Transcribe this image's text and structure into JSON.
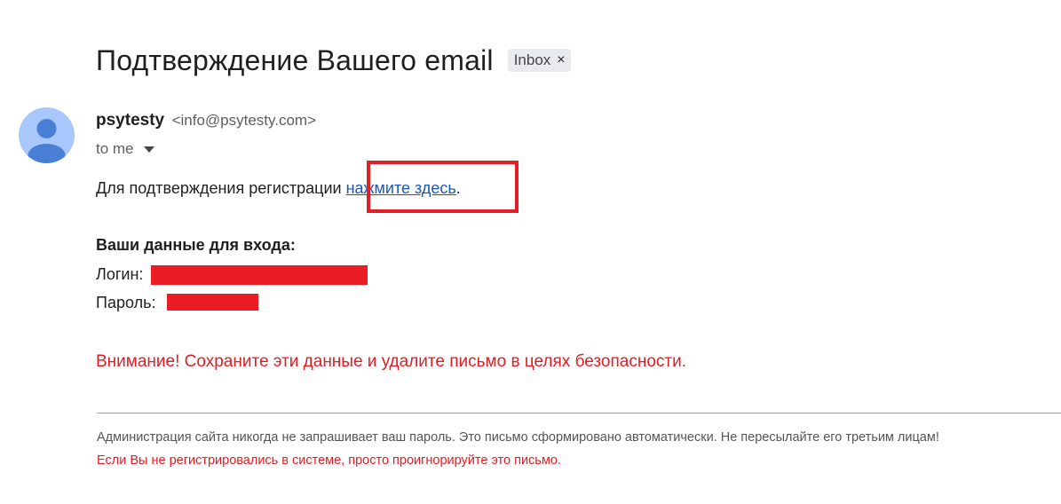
{
  "email": {
    "subject": "Подтверждение Вашего email",
    "label": "Inbox",
    "label_close": "×",
    "sender_name": "psytesty",
    "sender_email": "<info@psytesty.com>",
    "recipient": "to me",
    "avatar_icon": "person-icon",
    "caret_icon": "chevron-down-icon"
  },
  "body": {
    "confirm_text": "Для подтверждения регистрации ",
    "confirm_link": "нажмите здесь",
    "confirm_end": ".",
    "creds_heading": "Ваши данные для входа:",
    "login_label": "Логин:",
    "password_label": "Пароль:",
    "warning": "Внимание! Сохраните эти данные и удалите письмо в целях безопасности.",
    "footer_note": "Администрация сайта никогда не запрашивает ваш пароль. Это письмо сформировано автоматически. Не пересылайте его третьим лицам!",
    "footer_warning": "Если Вы не регистрировались в системе, просто проигнорируйте это письмо."
  },
  "colors": {
    "link": "#1a55b8",
    "warning": "#e31b23",
    "redaction": "#ec1c24",
    "highlight": "#e31e24",
    "avatar_bg": "#a8c7fa",
    "avatar_fg": "#4a7fd6"
  }
}
